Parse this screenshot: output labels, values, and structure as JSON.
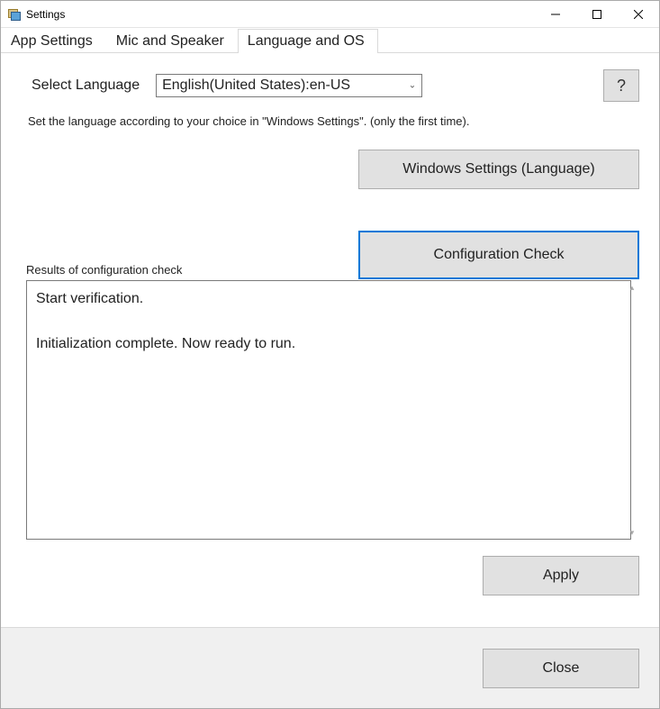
{
  "window": {
    "title": "Settings"
  },
  "tabs": [
    {
      "label": "App Settings",
      "active": false
    },
    {
      "label": "Mic and Speaker",
      "active": false
    },
    {
      "label": "Language and OS",
      "active": true
    }
  ],
  "language": {
    "label": "Select Language",
    "selected": "English(United States):en-US",
    "help_label": "?"
  },
  "note": "Set the language according to your choice in \"Windows Settings\". (only the first time).",
  "buttons": {
    "windows_settings": "Windows Settings (Language)",
    "config_check": "Configuration Check",
    "apply": "Apply",
    "close": "Close"
  },
  "results": {
    "label": "Results of configuration check",
    "text": "Start verification.\n\nInitialization complete. Now ready to run."
  }
}
